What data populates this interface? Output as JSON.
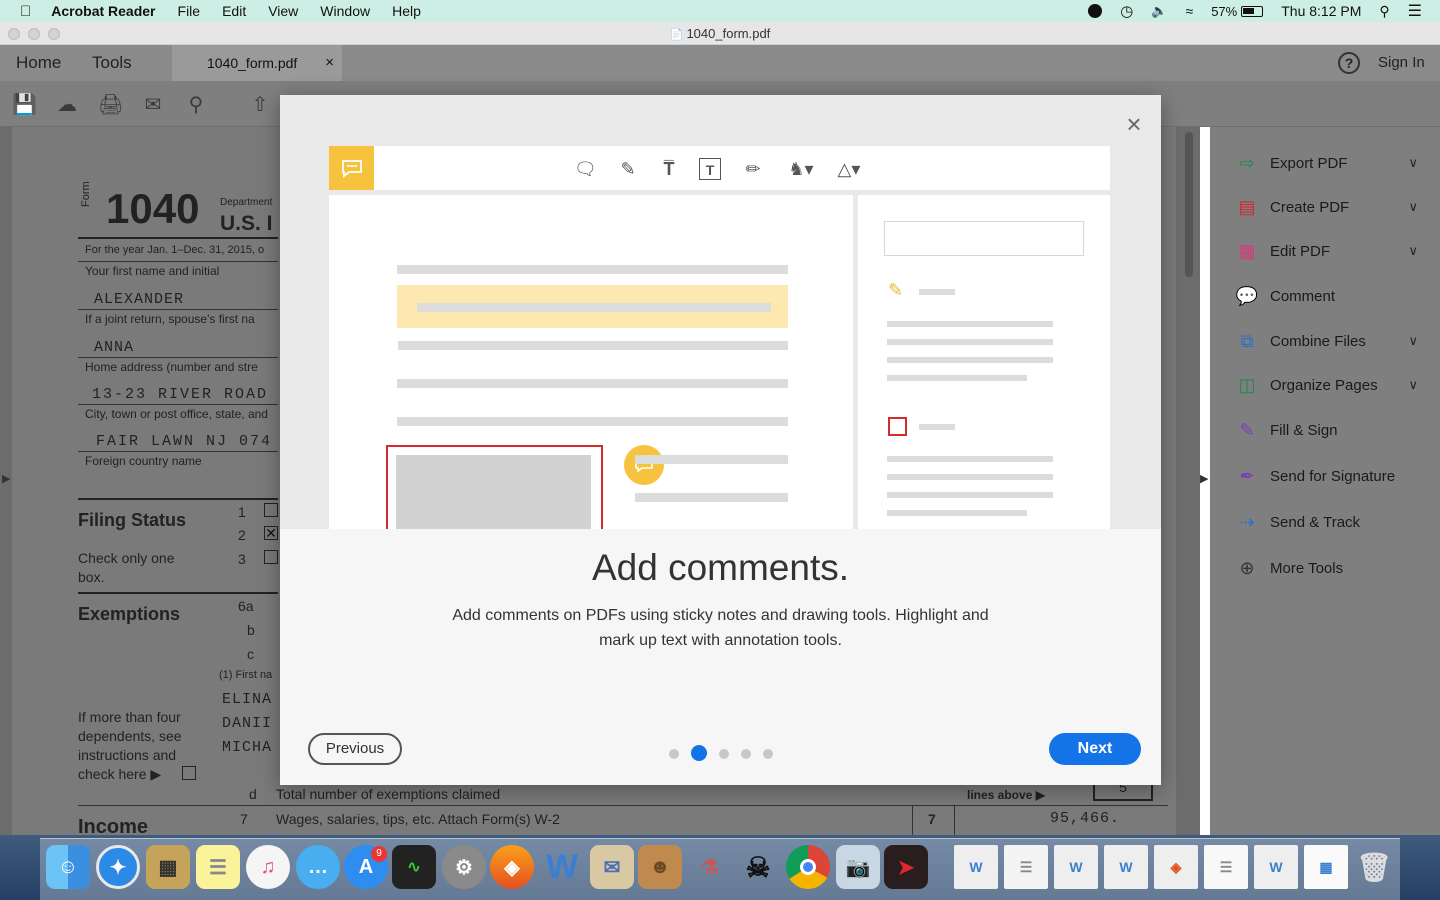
{
  "menubar": {
    "apple": "",
    "app_name": "Acrobat Reader",
    "menus": [
      "File",
      "Edit",
      "View",
      "Window",
      "Help"
    ],
    "battery": "57%",
    "clock": "Thu 8:12 PM"
  },
  "window": {
    "title": "1040_form.pdf"
  },
  "tabs": {
    "home": "Home",
    "tools": "Tools",
    "doc_tab": "1040_form.pdf",
    "close": "×",
    "help": "?",
    "sign_in": "Sign In"
  },
  "form": {
    "form_word": "Form",
    "form_number": "1040",
    "dept": "Department",
    "us": "U.S. I",
    "year_line": "For the year Jan. 1–Dec. 31, 2015, o",
    "first_name_label": "Your first name and initial",
    "first_name": "ALEXANDER",
    "spouse_label": "If a joint return, spouse's first na",
    "spouse": "ANNA",
    "home_label": "Home address (number and stre",
    "home": "13-23 RIVER ROAD",
    "city_label": "City, town or post office, state, and",
    "city": "FAIR LAWN NJ 074",
    "foreign_label": "Foreign country name",
    "filing_status": "Filing Status",
    "check_only": "Check only one",
    "box": "box.",
    "fs_nums": [
      "1",
      "2",
      "3"
    ],
    "exemptions": "Exemptions",
    "ex_labels": [
      "6a",
      "b",
      "c"
    ],
    "first_na": "(1)  First na",
    "dependents": [
      "ELINA",
      "DANII",
      "MICHA"
    ],
    "more_than": [
      "If more than four",
      "dependents, see",
      "instructions and",
      "check here ▶"
    ],
    "line_d": "d",
    "total_exemptions": "Total number of exemptions claimed",
    "lines_above": "lines above ▶",
    "exemptions_box": "5",
    "income": "Income",
    "line7": "7",
    "wages": "Wages, salaries, tips, etc. Attach Form(s) W-2",
    "line7b": "7",
    "wages_value": "95,466."
  },
  "right_panel": {
    "items": [
      {
        "label": "Export PDF",
        "icon": "export-pdf-icon",
        "color": "#1e8a4a",
        "chevron": true
      },
      {
        "label": "Create PDF",
        "icon": "create-pdf-icon",
        "color": "#d02a2a",
        "chevron": true
      },
      {
        "label": "Edit PDF",
        "icon": "edit-pdf-icon",
        "color": "#d43d7c",
        "chevron": true
      },
      {
        "label": "Comment",
        "icon": "comment-icon",
        "color": "#e8b931",
        "chevron": false
      },
      {
        "label": "Combine Files",
        "icon": "combine-files-icon",
        "color": "#2a6ed0",
        "chevron": true
      },
      {
        "label": "Organize Pages",
        "icon": "organize-pages-icon",
        "color": "#1e8a4a",
        "chevron": true
      },
      {
        "label": "Fill & Sign",
        "icon": "fill-sign-icon",
        "color": "#7b3fb5",
        "chevron": false
      },
      {
        "label": "Send for Signature",
        "icon": "send-signature-icon",
        "color": "#7b3fb5",
        "chevron": false
      },
      {
        "label": "Send & Track",
        "icon": "send-track-icon",
        "color": "#2a6ed0",
        "chevron": false
      },
      {
        "label": "More Tools",
        "icon": "more-tools-icon",
        "color": "#333333",
        "chevron": false
      }
    ]
  },
  "modal": {
    "title": "Add comments.",
    "description": "Add comments on PDFs using sticky notes and drawing tools. Highlight and mark up text with annotation tools.",
    "previous": "Previous",
    "next": "Next",
    "close": "×",
    "page_count": 5,
    "current_page": 2
  },
  "dock": {
    "appstore_badge": "9"
  }
}
